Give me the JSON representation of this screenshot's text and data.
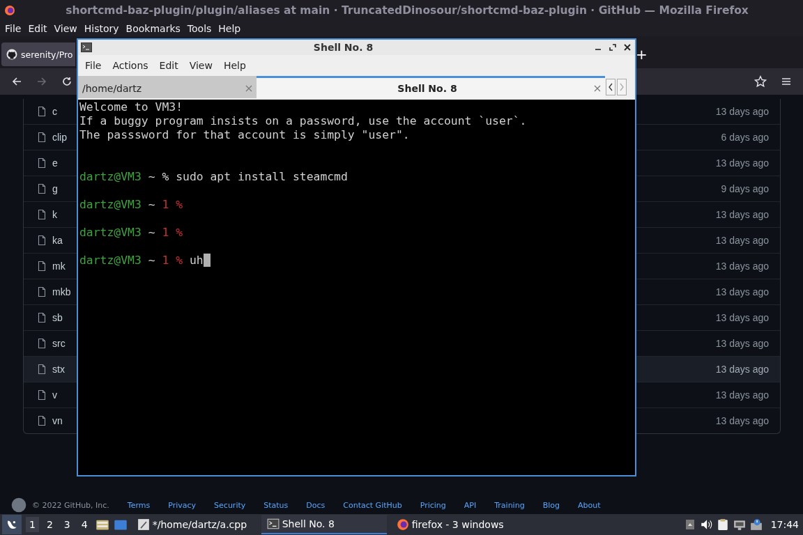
{
  "window": {
    "title": "shortcmd-baz-plugin/plugin/aliases at main · TruncatedDinosour/shortcmd-baz-plugin · GitHub — Mozilla Firefox"
  },
  "menu": [
    "File",
    "Edit",
    "View",
    "History",
    "Bookmarks",
    "Tools",
    "Help"
  ],
  "tabs": [
    {
      "label": "serenity/Pro",
      "selected": true
    },
    {
      "label": "+",
      "kind": "new"
    }
  ],
  "nav": {
    "forward_disabled": true
  },
  "files": [
    {
      "name": "c",
      "age": "13 days ago",
      "hovered": false
    },
    {
      "name": "clip",
      "age": "6 days ago",
      "hovered": false
    },
    {
      "name": "e",
      "age": "13 days ago",
      "hovered": false
    },
    {
      "name": "g",
      "age": "9 days ago",
      "hovered": false
    },
    {
      "name": "k",
      "age": "13 days ago",
      "hovered": false
    },
    {
      "name": "ka",
      "age": "13 days ago",
      "hovered": false
    },
    {
      "name": "mk",
      "age": "13 days ago",
      "hovered": false
    },
    {
      "name": "mkb",
      "age": "13 days ago",
      "hovered": false
    },
    {
      "name": "sb",
      "age": "13 days ago",
      "hovered": false
    },
    {
      "name": "src",
      "age": "13 days ago",
      "hovered": false
    },
    {
      "name": "stx",
      "age": "13 days ago",
      "hovered": true
    },
    {
      "name": "v",
      "age": "13 days ago",
      "hovered": false
    },
    {
      "name": "vn",
      "age": "13 days ago",
      "hovered": false
    }
  ],
  "footer": [
    "© 2022 GitHub, Inc.",
    "Terms",
    "Privacy",
    "Security",
    "Status",
    "Docs",
    "Contact GitHub",
    "Pricing",
    "API",
    "Training",
    "Blog",
    "About"
  ],
  "terminal": {
    "title": "Shell No. 8",
    "menu": [
      "File",
      "Actions",
      "Edit",
      "View",
      "Help"
    ],
    "tabs": [
      {
        "label": "/home/dartz",
        "selected": false
      },
      {
        "label": "Shell No. 8",
        "selected": true
      }
    ],
    "lines": [
      {
        "kind": "text",
        "segments": [
          {
            "kind": "plain",
            "text": "Welcome to VM3!"
          }
        ]
      },
      {
        "kind": "text",
        "segments": [
          {
            "kind": "plain",
            "text": "If a buggy program insists on a password, use the account `user`."
          }
        ]
      },
      {
        "kind": "text",
        "segments": [
          {
            "kind": "plain",
            "text": "The passsword for that account is simply \"user\"."
          }
        ]
      },
      {
        "kind": "blank"
      },
      {
        "kind": "blank"
      },
      {
        "kind": "text",
        "segments": [
          {
            "kind": "user",
            "text": "dartz@VM3"
          },
          {
            "kind": "plain",
            "text": " ~ % sudo apt install steamcmd"
          }
        ]
      },
      {
        "kind": "blank"
      },
      {
        "kind": "text",
        "segments": [
          {
            "kind": "user",
            "text": "dartz@VM3"
          },
          {
            "kind": "plain",
            "text": " ~ "
          },
          {
            "kind": "error",
            "text": "1 %"
          }
        ]
      },
      {
        "kind": "blank"
      },
      {
        "kind": "text",
        "segments": [
          {
            "kind": "user",
            "text": "dartz@VM3"
          },
          {
            "kind": "plain",
            "text": " ~ "
          },
          {
            "kind": "error",
            "text": "1 %"
          }
        ]
      },
      {
        "kind": "blank"
      },
      {
        "kind": "text",
        "cursor": true,
        "segments": [
          {
            "kind": "user",
            "text": "dartz@VM3"
          },
          {
            "kind": "plain",
            "text": " ~ "
          },
          {
            "kind": "error",
            "text": "1 %"
          },
          {
            "kind": "plain",
            "text": " uh"
          }
        ]
      }
    ]
  },
  "taskbar": {
    "workspaces": [
      {
        "label": "1",
        "selected": true
      },
      {
        "label": "2",
        "selected": false
      },
      {
        "label": "3",
        "selected": false
      },
      {
        "label": "4",
        "selected": false
      }
    ],
    "tasks": [
      {
        "label": "*/home/dartz/a.cpp",
        "kind": "editor",
        "selected": false
      },
      {
        "label": "Shell No. 8",
        "kind": "terminal",
        "selected": true
      },
      {
        "label": "firefox - 3 windows",
        "kind": "browser",
        "selected": false
      }
    ],
    "clock": "17:44"
  }
}
